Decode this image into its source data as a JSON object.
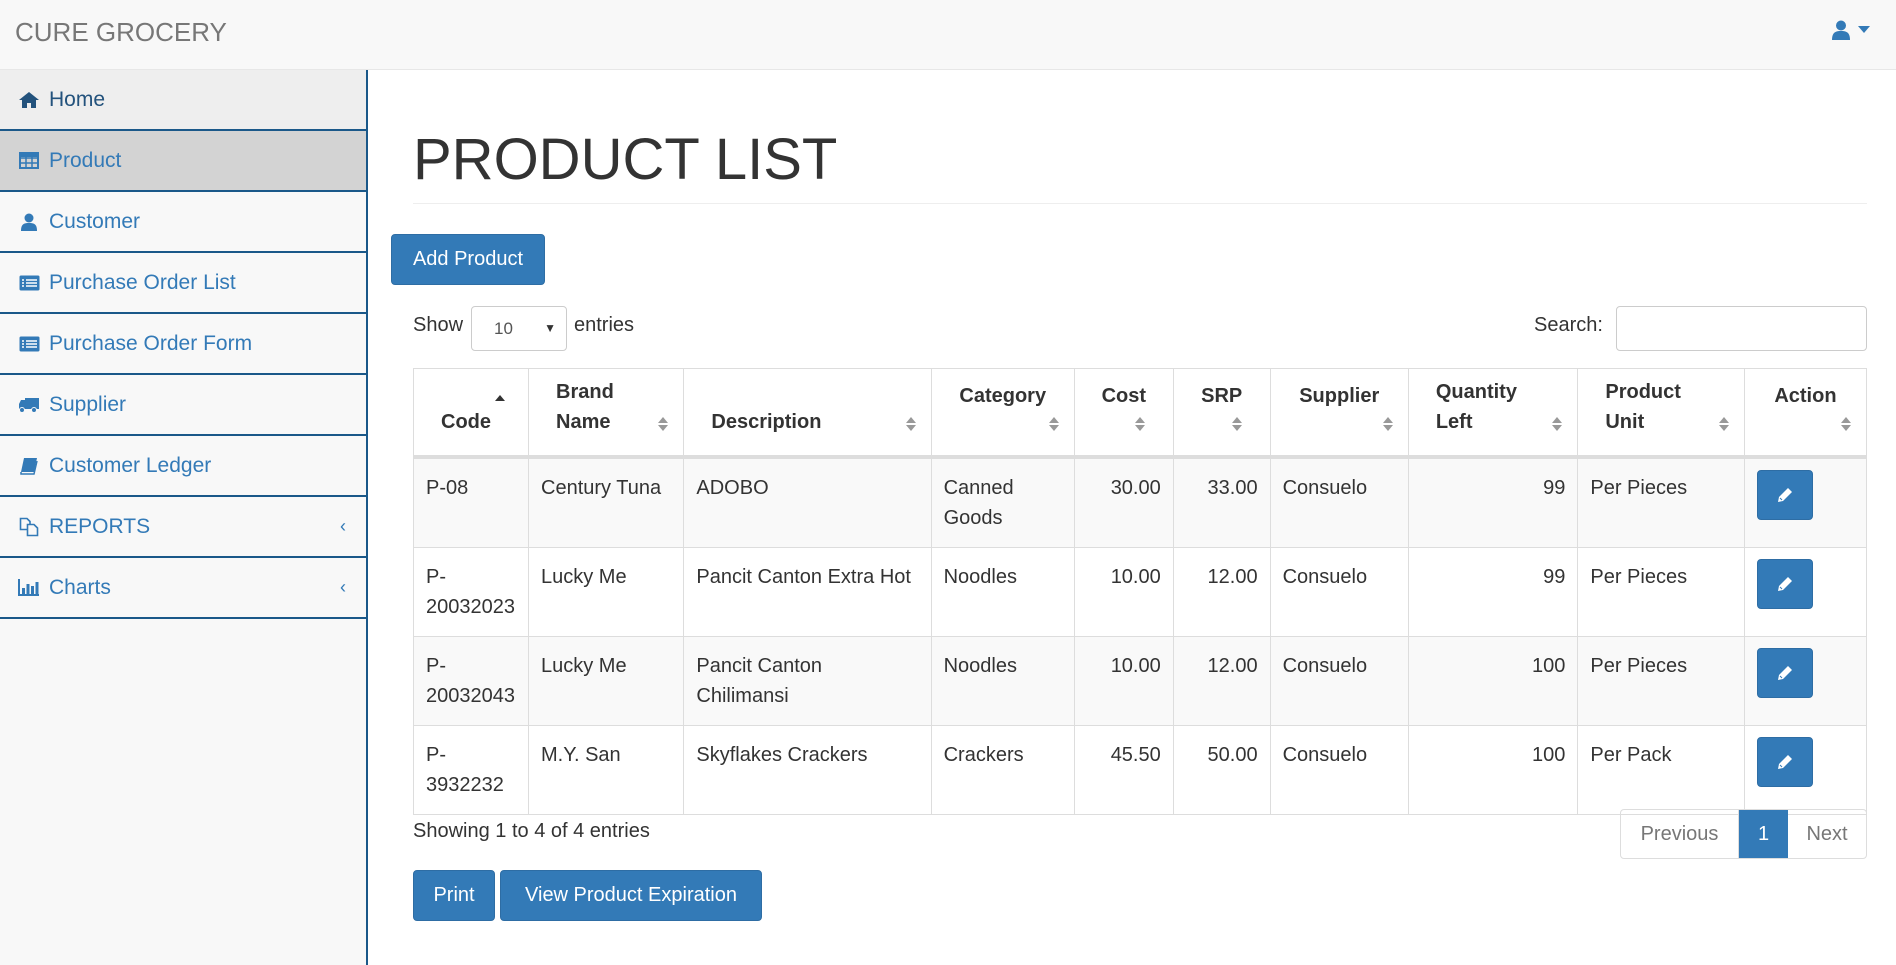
{
  "app": {
    "brand": "CURE GROCERY",
    "user_icon": "user-icon",
    "dropdown_icon": "caret-down-icon"
  },
  "sidebar": {
    "items": [
      {
        "label": "Home",
        "icon": "home-icon"
      },
      {
        "label": "Product",
        "icon": "table-icon",
        "active": true
      },
      {
        "label": "Customer",
        "icon": "user-icon"
      },
      {
        "label": "Purchase Order List",
        "icon": "list-alt-icon"
      },
      {
        "label": "Purchase Order Form",
        "icon": "list-alt-icon"
      },
      {
        "label": "Supplier",
        "icon": "truck-icon"
      },
      {
        "label": "Customer Ledger",
        "icon": "book-icon"
      },
      {
        "label": "REPORTS",
        "icon": "copy-icon",
        "expandable": true
      },
      {
        "label": "Charts",
        "icon": "bar-chart-icon",
        "expandable": true
      }
    ],
    "expand_glyph": "‹"
  },
  "main": {
    "title": "PRODUCT LIST",
    "add_button": "Add Product",
    "length": {
      "show_label": "Show",
      "value": "10",
      "entries_label": "entries"
    },
    "search": {
      "label": "Search:",
      "value": "",
      "placeholder": ""
    },
    "table": {
      "columns": [
        "Code",
        "Brand Name",
        "Description",
        "Category",
        "Cost",
        "SRP",
        "Supplier",
        "Quantity Left",
        "Product Unit",
        "Action"
      ],
      "sorted_column": "Code",
      "sort_direction": "ascending",
      "rows": [
        {
          "code": "P-08",
          "brand": "Century Tuna",
          "description": "ADOBO",
          "category": "Canned Goods",
          "cost": "30.00",
          "srp": "33.00",
          "supplier": "Consuelo",
          "qty": "99",
          "unit": "Per Pieces"
        },
        {
          "code": "P-20032023",
          "brand": "Lucky Me",
          "description": "Pancit Canton Extra Hot",
          "category": "Noodles",
          "cost": "10.00",
          "srp": "12.00",
          "supplier": "Consuelo",
          "qty": "99",
          "unit": "Per Pieces"
        },
        {
          "code": "P-20032043",
          "brand": "Lucky Me",
          "description": "Pancit Canton Chilimansi",
          "category": "Noodles",
          "cost": "10.00",
          "srp": "12.00",
          "supplier": "Consuelo",
          "qty": "100",
          "unit": "Per Pieces"
        },
        {
          "code": "P-3932232",
          "brand": "M.Y. San",
          "description": "Skyflakes Crackers",
          "category": "Crackers",
          "cost": "45.50",
          "srp": "50.00",
          "supplier": "Consuelo",
          "qty": "100",
          "unit": "Per Pack"
        }
      ]
    },
    "info": "Showing 1 to 4 of 4 entries",
    "pagination": {
      "previous": "Previous",
      "current": "1",
      "next": "Next"
    },
    "print_button": "Print",
    "expiration_button": "View Product Expiration"
  },
  "colors": {
    "primary": "#337ab7",
    "sidebar_border": "#1a5889",
    "active_item_bg": "#d3d3d3"
  }
}
